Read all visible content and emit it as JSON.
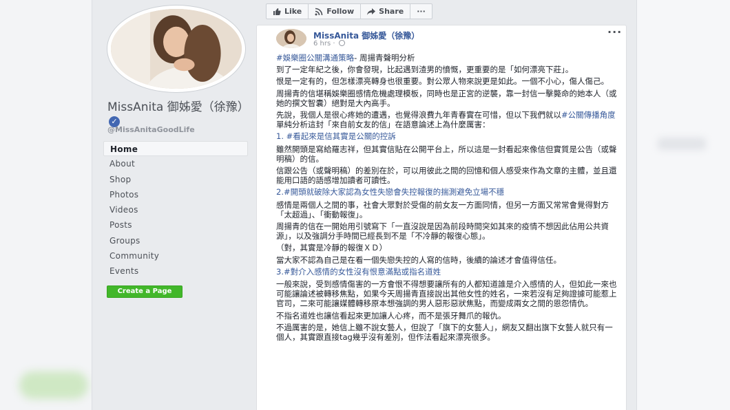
{
  "sidebar": {
    "page_name": "MissAnita 御姊愛（徐豫）",
    "handle": "@MissAnitaGoodLife",
    "nav": [
      "Home",
      "About",
      "Shop",
      "Photos",
      "Videos",
      "Posts",
      "Groups",
      "Community",
      "Events"
    ],
    "create_page": "Create a Page"
  },
  "actions": {
    "like": "Like",
    "follow": "Follow",
    "share": "Share",
    "more": "···"
  },
  "post": {
    "author": "MissAnita 御姊愛（徐豫）",
    "time": "6 hrs ·",
    "more": "···",
    "hashtag": "#娛樂圈公關溝通策略",
    "subtitle": "- 周揚青聲明分析",
    "p1": "到了一定年紀之後，你會發現，比起遇到渣男的憤慨，更重要的是「如何漂亮下莊」。",
    "p2": "恨是一定有的，但怎樣漂亮轉身也很重要。對公眾人物來說更是如此。一個不小心，傷人傷己。",
    "p3": "周揚青的信堪稱娛樂圈感情危機處理模板，同時也是正宮的逆襲，靠一封信一擊斃命的她本人（或她的撰文智囊）絕對是大內高手。",
    "p4a": "先說，我個人是很心疼她的遭遇，也覺得浪費九年青春實在可惜，但以下我們就以",
    "p4tag": "#公關傳播角度",
    "p4b": "單純分析這封「來自前女友的信」在語意論述上為什麼厲害：",
    "h1": "1. #看起來是信其實是公關的控訴",
    "p5": "雖然開頭是寫給羅志祥，但其實信貼在公開平台上，所以這是一封看起來像信但實質是公告（或聲明稿）的信。",
    "p6": "信跟公告（或聲明稿）的差別在於，可以用彼此之間的回憶和個人感受來作為文章的主體，並且還能用口語的語感增加讀者可讀性。",
    "h2": "2.#開頭就破除大家認為女性失戀會失控報復的揣測避免立場不穩",
    "p7": "感情是兩個人之間的事，社會大眾對於受傷的前女友一方面同情，但另一方面又常常會覺得對方「太超過」、「衝動報復」。",
    "p8": "周揚青的信在一開始用引號寫下「一直沒說是因為前段時間突如其來的疫情不想因此佔用公共資源」，以及強調分手時間已經長到不是「不冷靜的報復心態」。",
    "p9": "（對，其實是冷靜的報復ＸＤ）",
    "p10": "當大家不認為自己是在看一個失戀失控的人寫的信時，後續的論述才會值得信任。",
    "h3": "3.#對介入感情的女性沒有恨意滿點或指名道姓",
    "p11": "一般來說，受到感情傷害的一方會恨不得想要讓所有的人都知道誰是介入感情的人，但如此一來也可能讓論述被轉移焦點，如果今天周揚青直接說出其他女性的姓名，一來若沒有足夠證據可能惹上官司，二來可能讓媒體轉移原本想強調的男人惡形惡狀焦點，而變成兩女之間的恩怨情仇。",
    "p12": "不指名道姓也讓信看起來更加讓人心疼，而不是張牙舞爪的報仇。",
    "p13": "不過厲害的是，她信上雖不說女藝人，但說了「旗下的女藝人」，網友又翻出旗下女藝人就只有一個人，其實跟直接tag幾乎沒有差別，但作法看起來漂亮很多。"
  },
  "colors": {
    "link": "#365899",
    "button_green": "#42b72a",
    "verified": "#4267b2"
  }
}
